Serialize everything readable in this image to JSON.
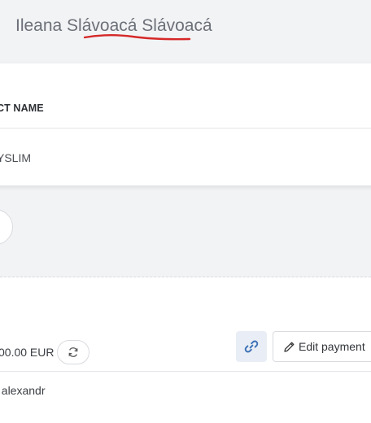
{
  "header": {
    "customer_name": "Ileana Slávoacá Slávoacá"
  },
  "product_table": {
    "column_header": "CT NAME",
    "rows": [
      {
        "product_name": "YSLIM"
      }
    ]
  },
  "payment": {
    "amount": "00.00 EUR",
    "edit_payment_label": "Edit payment",
    "payer": "t alexandr"
  },
  "icons": {
    "refresh": "refresh-icon",
    "link": "link-icon",
    "edit": "pencil-icon"
  },
  "colors": {
    "link_icon": "#3a6fb5",
    "spellcheck_underline": "#d62828"
  }
}
